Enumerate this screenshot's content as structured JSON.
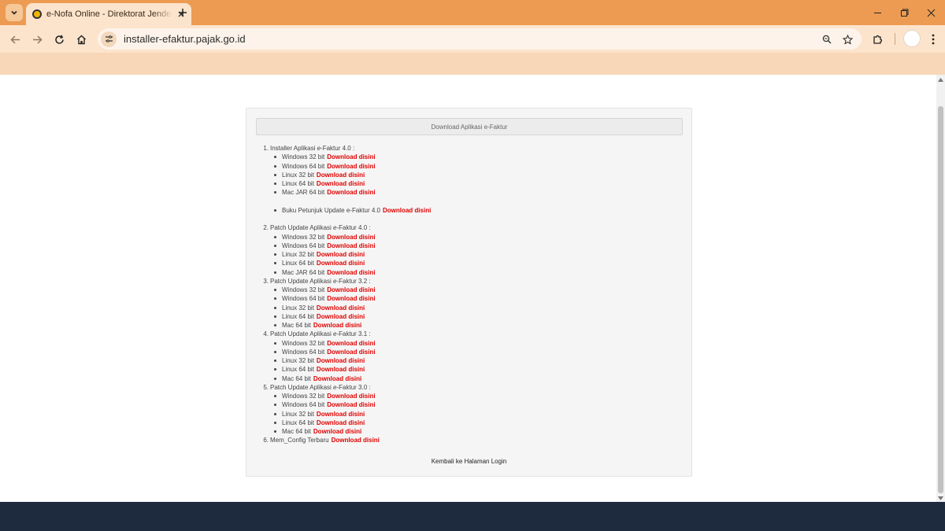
{
  "browser": {
    "tab_title": "e-Nofa Online - Direktorat Jenderal Pajak",
    "url": "installer-efaktur.pajak.go.id",
    "icons": [
      "tab-search-icon",
      "close-icon",
      "plus-icon",
      "minimize-icon",
      "restore-icon",
      "window-close-icon",
      "back-arrow-icon",
      "forward-arrow-icon",
      "reload-icon",
      "home-icon",
      "site-info-icon",
      "zoom-icon",
      "star-icon",
      "extensions-icon",
      "kebab-menu-icon"
    ],
    "accent": "#ed9b52"
  },
  "page": {
    "header": "Download Aplikasi e-Faktur",
    "link_color": "#e10000",
    "download_label": "Download disini",
    "sections": [
      {
        "num": "1.",
        "title_pre": "Installer Aplikasi ",
        "title_em": "e",
        "title_post": "-Faktur 4.0 :",
        "items": [
          "Windows 32 bit",
          "Windows 64 bit",
          "Linux 32 bit",
          "Linux 64 bit",
          "Mac JAR 64 bit"
        ],
        "extra": "Buku Petunjuk Update e-Faktur 4.0"
      },
      {
        "num": "2.",
        "title_pre": "Patch Update Aplikasi ",
        "title_em": "e",
        "title_post": "-Faktur 4.0 :",
        "items": [
          "Windows 32 bit",
          "Windows 64 bit",
          "Linux 32 bit",
          "Linux 64 bit",
          "Mac JAR 64 bit"
        ]
      },
      {
        "num": "3.",
        "title_pre": "Patch Update Aplikasi ",
        "title_em": "e",
        "title_post": "-Faktur 3.2 :",
        "items": [
          "Windows 32 bit",
          "Windows 64 bit",
          "Linux 32 bit",
          "Linux 64 bit",
          "Mac 64 bit"
        ]
      },
      {
        "num": "4.",
        "title_pre": "Patch Update Aplikasi ",
        "title_em": "e",
        "title_post": "-Faktur 3.1 :",
        "items": [
          "Windows 32 bit",
          "Windows 64 bit",
          "Linux 32 bit",
          "Linux 64 bit",
          "Mac 64 bit"
        ]
      },
      {
        "num": "5.",
        "title_pre": "Patch Update Aplikasi ",
        "title_em": "e",
        "title_post": "-Faktur 3.0 :",
        "items": [
          "Windows 32 bit",
          "Windows 64 bit",
          "Linux 32 bit",
          "Linux 64 bit",
          "Mac 64 bit"
        ]
      }
    ],
    "mem_config": {
      "num": "6.",
      "label": "Mem_Config Terbaru"
    },
    "back_link": "Kembali ke Halaman Login"
  }
}
